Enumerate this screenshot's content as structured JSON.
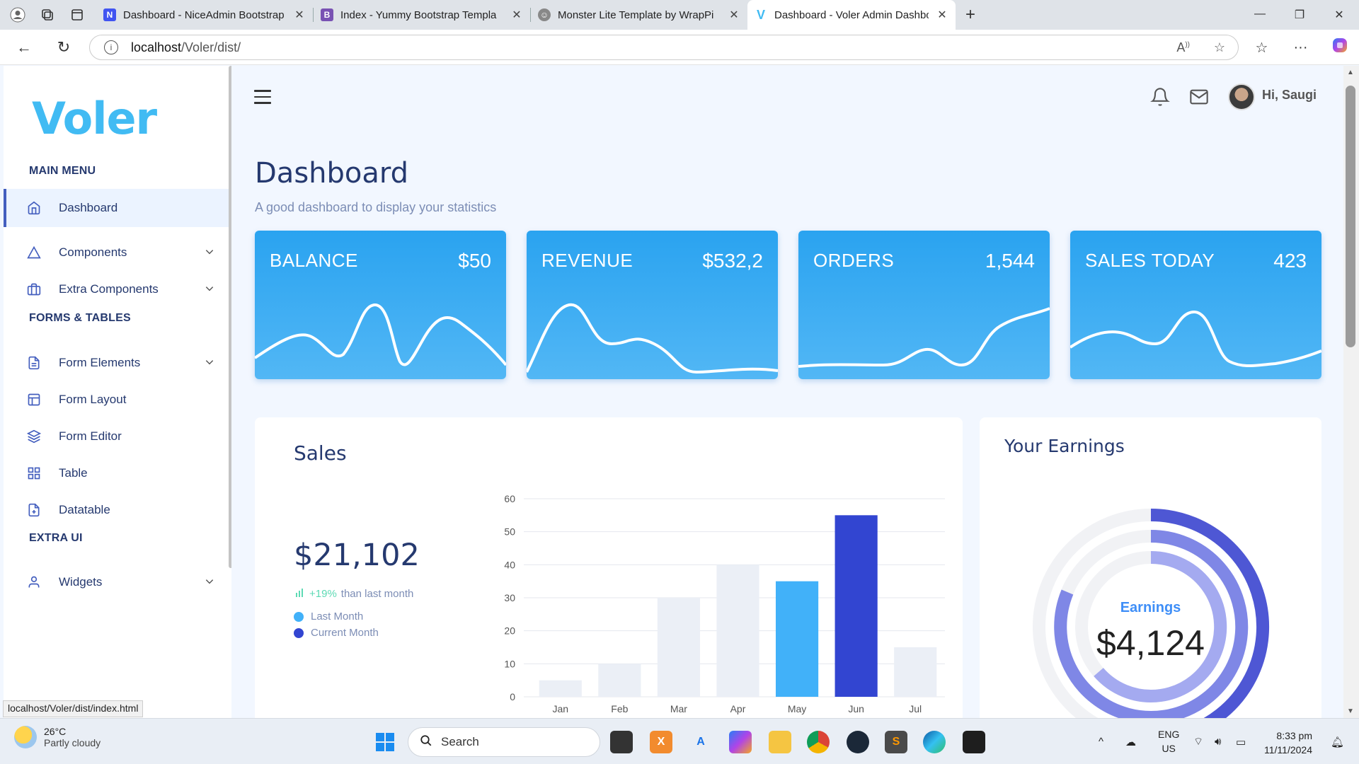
{
  "browser": {
    "tabs": [
      {
        "title": "Dashboard - NiceAdmin Bootstrap",
        "favicon": "niceadmin-icon",
        "color": "#4154f1"
      },
      {
        "title": "Index - Yummy Bootstrap Templa",
        "favicon": "bootstrap-icon",
        "color": "#7952b3"
      },
      {
        "title": "Monster Lite Template by WrapPi",
        "favicon": "monster-icon",
        "color": "#777777"
      },
      {
        "title": "Dashboard - Voler Admin Dashbo",
        "favicon": "voler-icon",
        "color": "#41bbf3"
      }
    ],
    "active_tab": 3,
    "url_host": "localhost",
    "url_path": "/Voler/dist/",
    "status_url": "localhost/Voler/dist/index.html"
  },
  "sidebar": {
    "logo": "Voler",
    "sections": [
      {
        "title": "MAIN MENU"
      },
      {
        "title": "FORMS & TABLES"
      },
      {
        "title": "EXTRA UI"
      }
    ],
    "items": [
      {
        "label": "Dashboard",
        "icon": "home-icon",
        "active": true
      },
      {
        "label": "Components",
        "icon": "triangle-icon",
        "dropdown": true
      },
      {
        "label": "Extra Components",
        "icon": "briefcase-icon",
        "dropdown": true
      },
      {
        "label": "Form Elements",
        "icon": "file-text-icon",
        "dropdown": true
      },
      {
        "label": "Form Layout",
        "icon": "layout-icon"
      },
      {
        "label": "Form Editor",
        "icon": "layers-icon"
      },
      {
        "label": "Table",
        "icon": "grid-icon"
      },
      {
        "label": "Datatable",
        "icon": "file-plus-icon"
      },
      {
        "label": "Widgets",
        "icon": "user-icon",
        "dropdown": true
      }
    ]
  },
  "header": {
    "greeting": "Hi, Saugi"
  },
  "page": {
    "title": "Dashboard",
    "subtitle": "A good dashboard to display your statistics"
  },
  "stats": [
    {
      "label": "BALANCE",
      "value": "$50"
    },
    {
      "label": "REVENUE",
      "value": "$532,2"
    },
    {
      "label": "ORDERS",
      "value": "1,544"
    },
    {
      "label": "SALES TODAY",
      "value": "423"
    }
  ],
  "sales": {
    "title": "Sales",
    "amount": "$21,102",
    "growth_pct": "+19%",
    "growth_text": "than last month",
    "legend": [
      {
        "name": "Last Month",
        "color": "#41b1f9"
      },
      {
        "name": "Current Month",
        "color": "#3245d1"
      }
    ]
  },
  "chart_data": {
    "type": "bar",
    "categories": [
      "Jan",
      "Feb",
      "Mar",
      "Apr",
      "May",
      "Jun",
      "Jul"
    ],
    "values": [
      5,
      10,
      30,
      40,
      35,
      55,
      15
    ],
    "bar_colors": [
      "#ebeff6",
      "#ebeff6",
      "#ebeff6",
      "#ebeff6",
      "#41b1f9",
      "#3245d1",
      "#ebeff6"
    ],
    "ylim": [
      0,
      60
    ],
    "yticks": [
      0,
      10,
      20,
      30,
      40,
      50,
      60
    ],
    "grid": true
  },
  "earnings": {
    "title": "Your Earnings",
    "label": "Earnings",
    "value": "$4,124"
  },
  "taskbar": {
    "temp": "26°C",
    "weather": "Partly cloudy",
    "search": "Search",
    "lang1": "ENG",
    "lang2": "US",
    "time": "8:33 pm",
    "date": "11/11/2024"
  }
}
